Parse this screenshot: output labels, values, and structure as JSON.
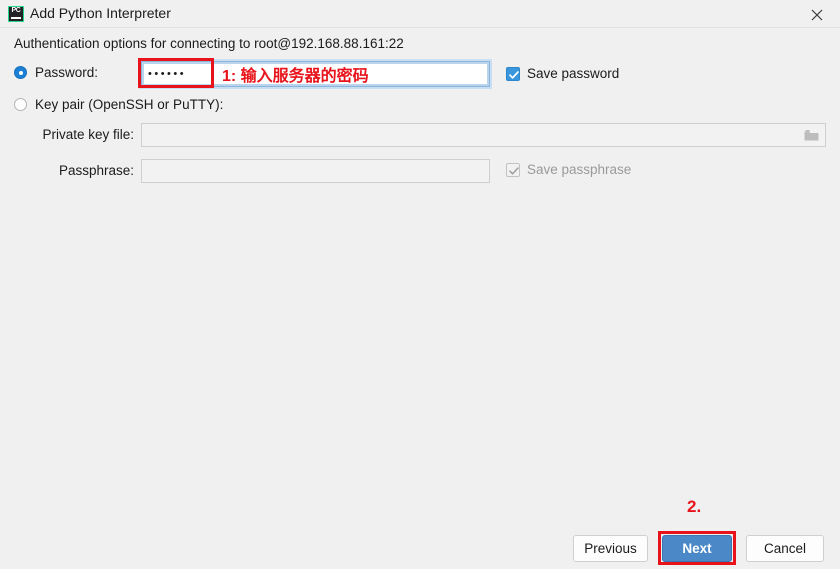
{
  "window": {
    "title": "Add Python Interpreter",
    "app_icon": "pycharm-icon",
    "icon_text": "PC",
    "close_icon": "close-icon"
  },
  "header": {
    "text": "Authentication options for connecting to root@192.168.88.161:22"
  },
  "auth": {
    "selected_mode": "password",
    "password_option": {
      "label": "Password:",
      "radio_state": "selected"
    },
    "keypair_option": {
      "label": "Key pair (OpenSSH or PuTTY):",
      "radio_state": "unselected"
    },
    "password_field": {
      "value": "••••••",
      "masked_char_count": 6,
      "focused": true
    },
    "save_password": {
      "label": "Save password",
      "checked": true,
      "enabled": true
    },
    "private_key_field": {
      "label": "Private key file:",
      "value": "",
      "enabled": false,
      "browse_icon": "folder-icon"
    },
    "passphrase_field": {
      "label": "Passphrase:",
      "value": "",
      "enabled": false
    },
    "save_passphrase": {
      "label": "Save passphrase",
      "checked": true,
      "enabled": false
    }
  },
  "annotations": {
    "step1_text": "1: 输入服务器的密码",
    "step2_text": "2.",
    "color": "#e8131a"
  },
  "buttons": {
    "previous": "Previous",
    "next": "Next",
    "cancel": "Cancel"
  },
  "colors": {
    "dialog_background": "#f0f0f0",
    "primary_button": "#4a88c7",
    "accent_blue": "#1c7fd6",
    "annotation_red": "#e8131a"
  }
}
